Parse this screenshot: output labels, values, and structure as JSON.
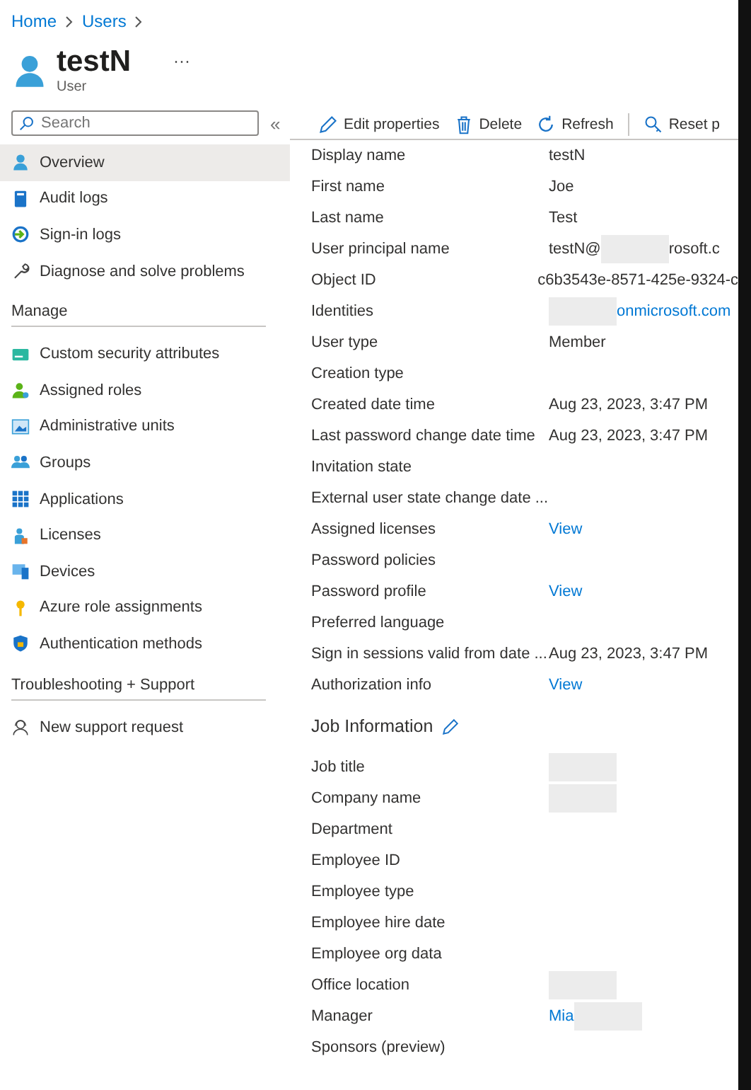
{
  "breadcrumb": [
    {
      "label": "Home"
    },
    {
      "label": "Users"
    }
  ],
  "header": {
    "title": "testN",
    "subtitle": "User",
    "more": "···"
  },
  "search": {
    "placeholder": "Search"
  },
  "collapse": "«",
  "sidebar": {
    "items": [
      {
        "label": "Overview",
        "selected": true
      },
      {
        "label": "Audit logs",
        "selected": false
      },
      {
        "label": "Sign-in logs",
        "selected": false
      },
      {
        "label": "Diagnose and solve problems",
        "selected": false
      }
    ],
    "sections": [
      {
        "title": "Manage",
        "items": [
          {
            "label": "Custom security attributes",
            "selected": false
          },
          {
            "label": "Assigned roles",
            "selected": false
          },
          {
            "label": "Administrative units",
            "selected": false
          },
          {
            "label": "Groups",
            "selected": false
          },
          {
            "label": "Applications",
            "selected": false
          },
          {
            "label": "Licenses",
            "selected": false
          },
          {
            "label": "Devices",
            "selected": false
          },
          {
            "label": "Azure role assignments",
            "selected": false
          },
          {
            "label": "Authentication methods",
            "selected": false
          }
        ]
      },
      {
        "title": "Troubleshooting + Support",
        "items": [
          {
            "label": "New support request",
            "selected": false
          }
        ]
      }
    ]
  },
  "toolbar": [
    {
      "label": "Edit properties"
    },
    {
      "label": "Delete"
    },
    {
      "label": "Refresh"
    },
    {
      "label": "Reset p"
    }
  ],
  "properties": [
    {
      "label": "Display name",
      "value": [
        {
          "kind": "text",
          "text": "testN"
        }
      ]
    },
    {
      "label": "First name",
      "value": [
        {
          "kind": "text",
          "text": "Joe"
        }
      ]
    },
    {
      "label": "Last name",
      "value": [
        {
          "kind": "text",
          "text": "Test"
        }
      ]
    },
    {
      "label": "User principal name",
      "value": [
        {
          "kind": "text",
          "text": "testN@"
        },
        {
          "kind": "redacted"
        },
        {
          "kind": "text",
          "text": "rosoft.c"
        }
      ]
    },
    {
      "label": "Object ID",
      "value": [
        {
          "kind": "text",
          "text": "c6b3543e-8571-425e-9324-c"
        }
      ]
    },
    {
      "label": "Identities",
      "value": [
        {
          "kind": "redacted"
        },
        {
          "kind": "link",
          "text": "onmicrosoft.com"
        }
      ]
    },
    {
      "label": "User type",
      "value": [
        {
          "kind": "text",
          "text": "Member"
        }
      ]
    },
    {
      "label": "Creation type"
    },
    {
      "label": "Created date time",
      "value": [
        {
          "kind": "text",
          "text": "Aug 23, 2023, 3:47 PM"
        }
      ]
    },
    {
      "label": "Last password change date time",
      "value": [
        {
          "kind": "text",
          "text": "Aug 23, 2023, 3:47 PM"
        }
      ]
    },
    {
      "label": "Invitation state"
    },
    {
      "label": "External user state change date ..."
    },
    {
      "label": "Assigned licenses",
      "value": [
        {
          "kind": "link",
          "text": "View"
        }
      ]
    },
    {
      "label": "Password policies"
    },
    {
      "label": "Password profile",
      "value": [
        {
          "kind": "link",
          "text": "View"
        }
      ]
    },
    {
      "label": "Preferred language"
    },
    {
      "label": "Sign in sessions valid from date ...",
      "value": [
        {
          "kind": "text",
          "text": "Aug 23, 2023, 3:47 PM"
        }
      ]
    },
    {
      "label": "Authorization info",
      "value": [
        {
          "kind": "link",
          "text": "View"
        }
      ]
    }
  ],
  "job_information": {
    "title": "Job Information",
    "rows": [
      {
        "label": "Job title",
        "value": [
          {
            "kind": "redacted"
          }
        ]
      },
      {
        "label": "Company name",
        "value": [
          {
            "kind": "redacted"
          }
        ]
      },
      {
        "label": "Department"
      },
      {
        "label": "Employee ID"
      },
      {
        "label": "Employee type"
      },
      {
        "label": "Employee hire date"
      },
      {
        "label": "Employee org data"
      },
      {
        "label": "Office location",
        "value": [
          {
            "kind": "redacted"
          }
        ]
      },
      {
        "label": "Manager",
        "value": [
          {
            "kind": "link",
            "text": "Mia"
          },
          {
            "kind": "redacted"
          }
        ]
      },
      {
        "label": "Sponsors (preview)"
      }
    ]
  }
}
